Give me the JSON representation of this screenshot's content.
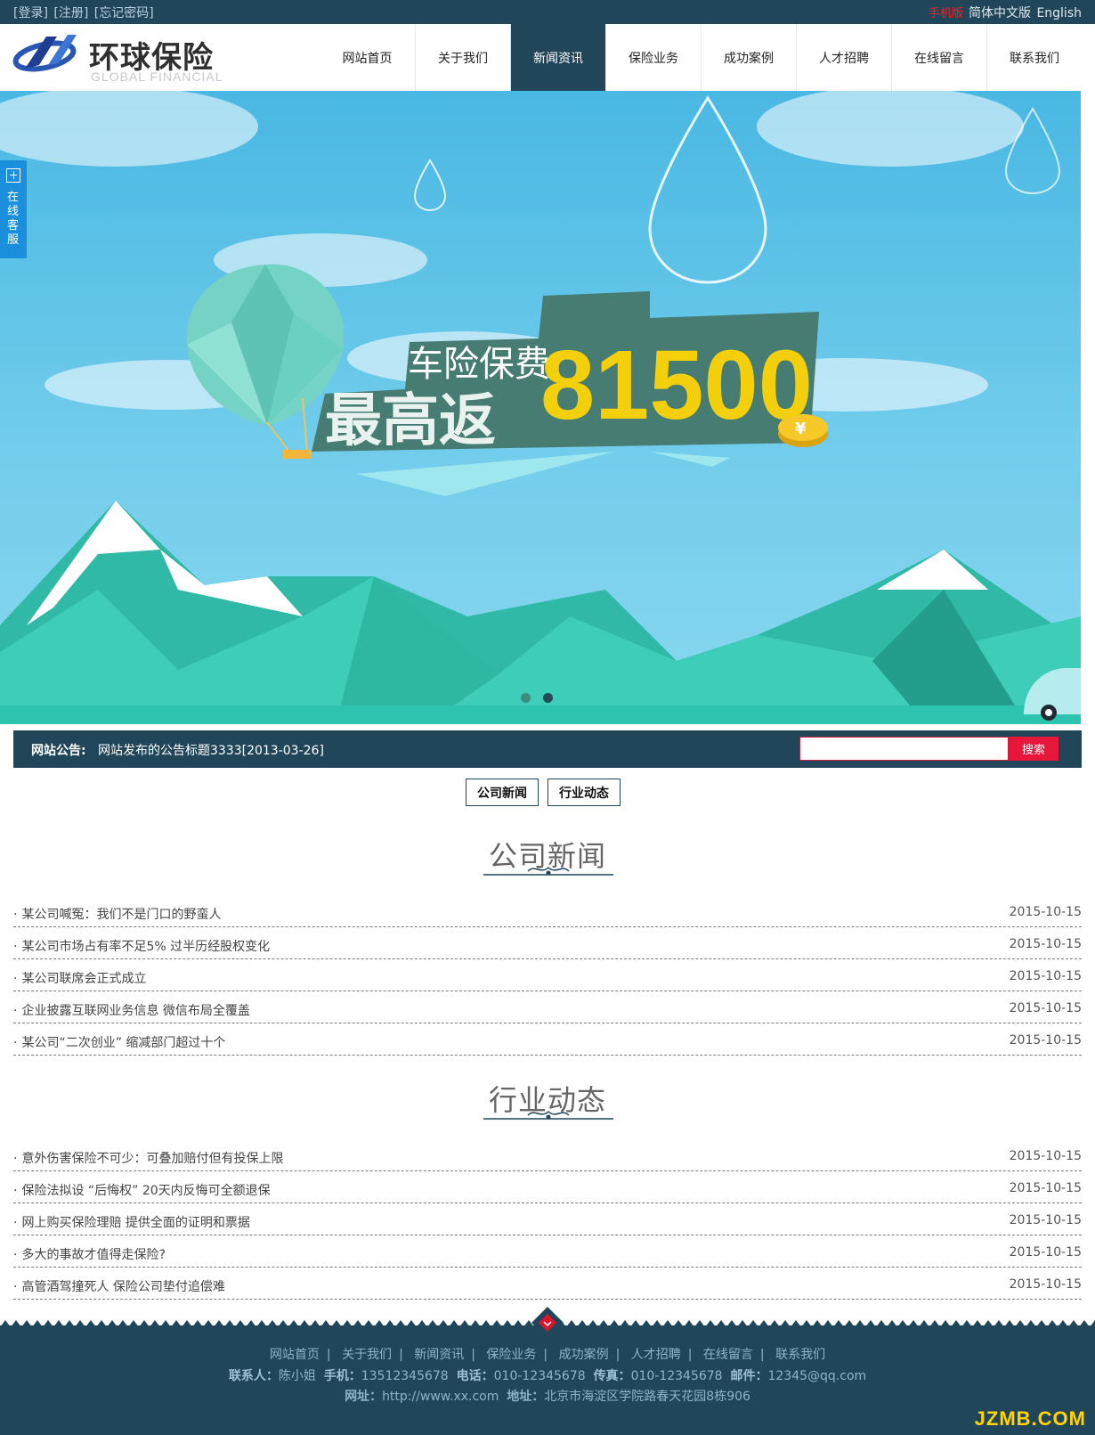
{
  "topbar": {
    "login": "[登录]",
    "register": "[注册]",
    "forgot": "[忘记密码]",
    "mobile": "手机版",
    "lang_cn": "简体中文版",
    "lang_en": "English"
  },
  "logo": {
    "cn": "环球保险",
    "en": "GLOBAL FINANCIAL"
  },
  "nav": [
    "网站首页",
    "关于我们",
    "新闻资讯",
    "保险业务",
    "成功案例",
    "人才招聘",
    "在线留言",
    "联系我们"
  ],
  "nav_active": "新闻资讯",
  "banner": {
    "line1": "车险保费",
    "line2": "最高返",
    "amount": "81500",
    "coin_symbol": "¥",
    "slides": 2,
    "active_slide": 2
  },
  "service": {
    "label": "在线客服"
  },
  "notice": {
    "label": "网站公告:",
    "message": "网站发布的公告标题3333[2013-03-26]",
    "search_value": "",
    "search_button": "搜索"
  },
  "tabs": [
    "公司新闻",
    "行业动态"
  ],
  "company_news": {
    "title": "公司新闻",
    "items": [
      {
        "title": "某公司喊冤：我们不是门口的野蛮人",
        "date": "2015-10-15"
      },
      {
        "title": "某公司市场占有率不足5% 过半历经股权变化",
        "date": "2015-10-15"
      },
      {
        "title": "某公司联席会正式成立",
        "date": "2015-10-15"
      },
      {
        "title": "企业披露互联网业务信息 微信布局全覆盖",
        "date": "2015-10-15"
      },
      {
        "title": "某公司“二次创业” 缩减部门超过十个",
        "date": "2015-10-15"
      }
    ]
  },
  "industry_news": {
    "title": "行业动态",
    "items": [
      {
        "title": "意外伤害保险不可少：可叠加赔付但有投保上限",
        "date": "2015-10-15"
      },
      {
        "title": "保险法拟设 “后悔权” 20天内反悔可全额退保",
        "date": "2015-10-15"
      },
      {
        "title": "网上购买保险理赔 提供全面的证明和票据",
        "date": "2015-10-15"
      },
      {
        "title": "多大的事故才值得走保险?",
        "date": "2015-10-15"
      },
      {
        "title": "高管酒驾撞死人 保险公司垫付追偿难",
        "date": "2015-10-15"
      }
    ]
  },
  "footer": {
    "links": [
      "网站首页",
      "关于我们",
      "新闻资讯",
      "保险业务",
      "成功案例",
      "人才招聘",
      "在线留言",
      "联系我们"
    ],
    "contact_label": "联系人：",
    "contact": "陈小姐",
    "mobile_label": "手机：",
    "mobile": "13512345678",
    "phone_label": "电话：",
    "phone": "010-12345678",
    "fax_label": "传真：",
    "fax": "010-12345678",
    "email_label": "邮件：",
    "email": "12345@qq.com",
    "site_label": "网址：",
    "site": "http://www.xx.com",
    "address_label": "地址：",
    "address": "北京市海淀区学院路春天花园8栋906",
    "watermark": "JZMB.COM"
  },
  "colors": {
    "primary": "#21465a",
    "accent": "#e8163b",
    "service": "#1b8fdc",
    "gold": "#f4c90a"
  }
}
